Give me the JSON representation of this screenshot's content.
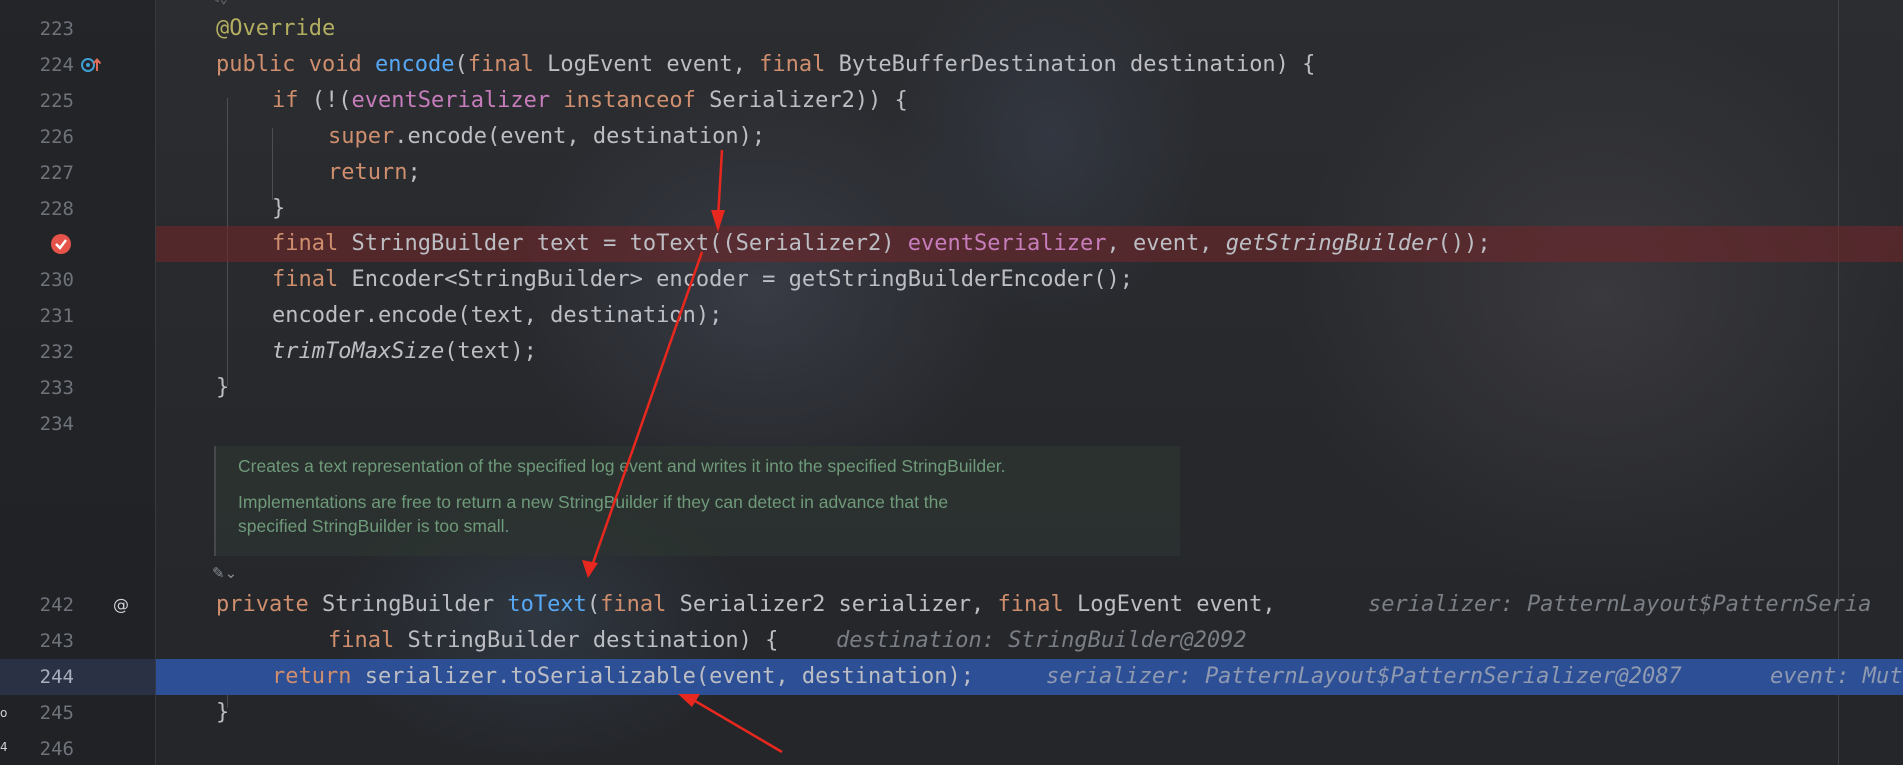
{
  "editor": {
    "lines": [
      {
        "num": "223"
      },
      {
        "num": "224"
      },
      {
        "num": "225"
      },
      {
        "num": "226"
      },
      {
        "num": "227"
      },
      {
        "num": "228"
      },
      {
        "num": ""
      },
      {
        "num": "230"
      },
      {
        "num": "231"
      },
      {
        "num": "232"
      },
      {
        "num": "233"
      },
      {
        "num": "234"
      },
      {
        "num": "242"
      },
      {
        "num": "243"
      },
      {
        "num": "244"
      },
      {
        "num": "245"
      },
      {
        "num": "246"
      }
    ],
    "code": {
      "l223": {
        "annotation": "@Override"
      },
      "l224": {
        "kw1": "public",
        "kw2": "void",
        "name": "encode",
        "p1": "(",
        "kw3": "final",
        "t1": " LogEvent event, ",
        "kw4": "final",
        "t2": " ByteBufferDestination destination) {"
      },
      "l225": {
        "kw1": "if",
        "t1": " (!(",
        "field": "eventSerializer",
        "kw2": "instanceof",
        "t2": " Serializer2)) {"
      },
      "l226": {
        "kw1": "super",
        "t1": ".encode(event, destination);"
      },
      "l227": {
        "kw1": "return",
        "t1": ";"
      },
      "l228": {
        "t1": "}"
      },
      "l229": {
        "kw1": "final",
        "t1": " StringBuilder text = toText((Serializer2) ",
        "field": "eventSerializer",
        "t2": ", event, ",
        "italic": "getStringBuilder",
        "t3": "());"
      },
      "l230": {
        "kw1": "final",
        "t1": " Encoder<StringBuilder> encoder = getStringBuilderEncoder();"
      },
      "l231": {
        "t1": "encoder.encode(text, destination);"
      },
      "l232": {
        "italic": "trimToMaxSize",
        "t1": "(text);"
      },
      "l233": {
        "t1": "}"
      },
      "l242": {
        "kw1": "private",
        "t1": " StringBuilder ",
        "name": "toText",
        "t2": "(",
        "kw2": "final",
        "t3": " Serializer2 serializer, ",
        "kw3": "final",
        "t4": " LogEvent event,",
        "hint": "serializer: PatternLayout$PatternSeria"
      },
      "l243": {
        "kw1": "final",
        "t1": " StringBuilder destination) {",
        "hint": "destination: StringBuilder@2092"
      },
      "l244": {
        "kw1": "return",
        "t1": " serializer.toSerializable(event, destination);",
        "hint1": "serializer: PatternLayout$PatternSerializer@2087",
        "hint2": "event: Mut"
      },
      "l245": {
        "t1": "}"
      }
    },
    "doc": {
      "p1": "Creates a text representation of the specified log event and writes it into the specified StringBuilder.",
      "p2a": "Implementations are free to return a new StringBuilder if they can detect in advance that the",
      "p2b": "specified StringBuilder is too small."
    },
    "gutter_icons": {
      "l224": "override-method-icon",
      "l229": "breakpoint-icon",
      "l242": "annotation-at-icon"
    },
    "fold_label": "⌄",
    "colors": {
      "keyword": "#cf8e6d",
      "function": "#56a8f5",
      "field": "#c77dbb",
      "annotation": "#b3ae60",
      "breakpoint_line": "#6e262a",
      "execution_line": "#2d4f96",
      "arrow": "#e8281e"
    }
  }
}
